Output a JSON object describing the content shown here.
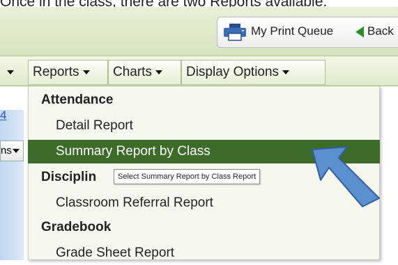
{
  "top_caption": "Once in the class, there are two Reports available:",
  "header": {
    "print_queue_label": "My Print Queue",
    "back_label": "Back"
  },
  "menubar": {
    "items": [
      {
        "label": "Reports"
      },
      {
        "label": "Charts"
      },
      {
        "label": "Display Options"
      }
    ]
  },
  "left_panel": {
    "number": "4",
    "select_text": "ns"
  },
  "dropdown": {
    "rows": [
      {
        "label": "Attendance",
        "kind": "header"
      },
      {
        "label": "Detail Report",
        "kind": "item"
      },
      {
        "label": "Summary Report by Class",
        "kind": "item",
        "selected": true
      },
      {
        "label": "Disciplin",
        "kind": "header"
      },
      {
        "label": "Classroom Referral Report",
        "kind": "item"
      },
      {
        "label": "Gradebook",
        "kind": "header"
      },
      {
        "label": "Grade Sheet Report",
        "kind": "item"
      }
    ]
  },
  "tooltip": "Select Summary Report by Class Report",
  "colors": {
    "selected_bg": "#3d6b2a",
    "arrow_fill": "#5b8fd0",
    "header_band": "#d7e4c0"
  }
}
